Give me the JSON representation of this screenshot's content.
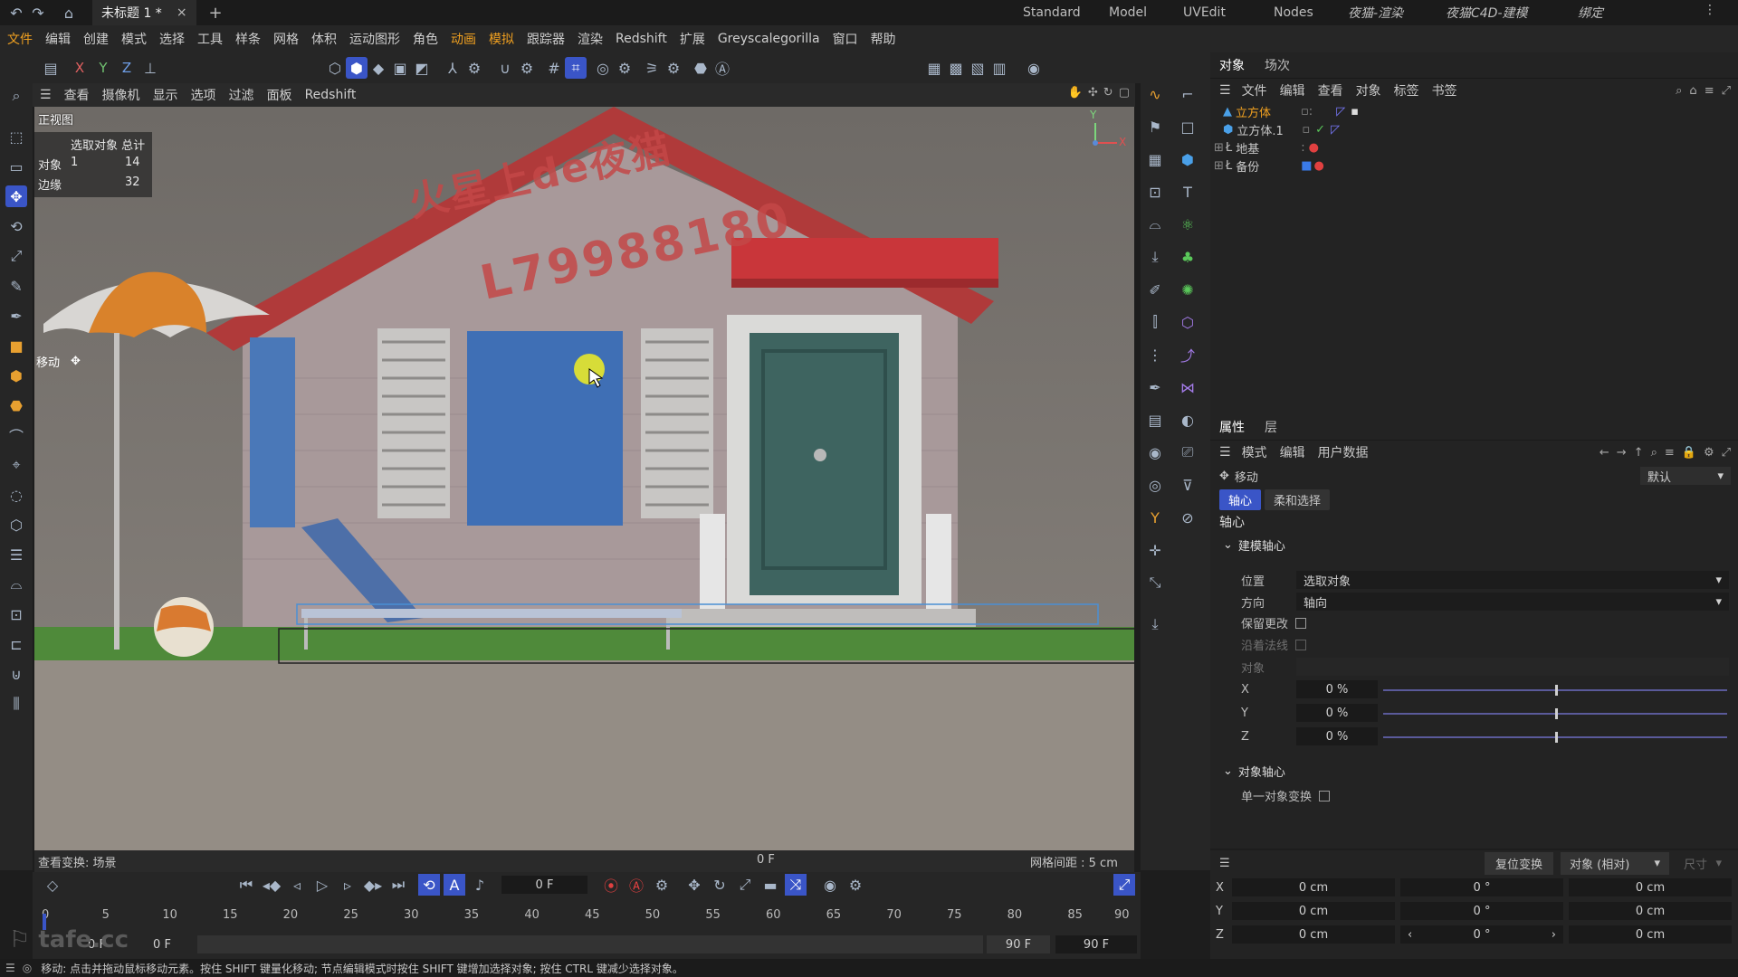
{
  "window": {
    "doc_tab": "未标题 1 *",
    "layouts": [
      "Standard",
      "Model",
      "UVEdit",
      "Nodes",
      "夜猫-渲染",
      "夜猫C4D-建模",
      "绑定"
    ]
  },
  "menu": [
    "文件",
    "编辑",
    "创建",
    "模式",
    "选择",
    "工具",
    "样条",
    "网格",
    "体积",
    "运动图形",
    "角色",
    "动画",
    "模拟",
    "跟踪器",
    "渲染",
    "Redshift",
    "扩展",
    "Greyscalegorilla",
    "窗口",
    "帮助"
  ],
  "axes": {
    "x": "X",
    "y": "Y",
    "z": "Z"
  },
  "viewport_menu": [
    "查看",
    "摄像机",
    "显示",
    "选项",
    "过滤",
    "面板",
    "Redshift"
  ],
  "viewport": {
    "name": "正视图",
    "stats": {
      "header": "选取对象 总计",
      "rows": [
        {
          "label": "对象",
          "selected": "1",
          "total": "14"
        },
        {
          "label": "边缘",
          "selected": "",
          "total": "32"
        }
      ]
    },
    "tool_label": "移动",
    "watermark_line1": "火星上de夜猫",
    "watermark_line2": "L79988180",
    "footer_left": "查看变换: 场景",
    "footer_center": "0 F",
    "footer_right": "网格间距 : 5 cm",
    "axis_y": "Y",
    "axis_x": "X"
  },
  "object_panel": {
    "tabs": [
      "对象",
      "场次"
    ],
    "menu": [
      "文件",
      "编辑",
      "查看",
      "对象",
      "标签",
      "书签"
    ],
    "items": [
      "立方体",
      "立方体.1",
      "地基",
      "备份"
    ]
  },
  "attr_panel": {
    "tabs": [
      "属性",
      "层"
    ],
    "menu": [
      "模式",
      "编辑",
      "用户数据"
    ],
    "tool": "移动",
    "preset": "默认",
    "subtabs": [
      "轴心",
      "柔和选择"
    ],
    "section": "轴心",
    "group1": "建模轴心",
    "position_label": "位置",
    "position_value": "选取对象",
    "direction_label": "方向",
    "direction_value": "轴向",
    "keep_changes": "保留更改",
    "along_normal": "沿着法线",
    "object_label": "对象",
    "x_label": "X",
    "y_label": "Y",
    "z_label": "Z",
    "x_value": "0 %",
    "y_value": "0 %",
    "z_value": "0 %",
    "slider_fraction": 0.5,
    "group2": "对象轴心",
    "single_object": "单一对象变换"
  },
  "coords": {
    "reset": "复位变换",
    "mode": "对象 (相对)",
    "size_label": "尺寸",
    "rows": [
      {
        "axis": "X",
        "pos": "0 cm",
        "rot": "0 °",
        "size": "0 cm"
      },
      {
        "axis": "Y",
        "pos": "0 cm",
        "rot": "0 °",
        "size": "0 cm"
      },
      {
        "axis": "Z",
        "pos": "0 cm",
        "rot": "0 °",
        "size": "0 cm"
      }
    ]
  },
  "timeline": {
    "current_frame": "0 F",
    "ruler": [
      "0",
      "5",
      "10",
      "15",
      "20",
      "25",
      "30",
      "35",
      "40",
      "45",
      "50",
      "55",
      "60",
      "65",
      "70",
      "75",
      "80",
      "85",
      "90"
    ],
    "start": "0 F",
    "start2": "0 F",
    "end": "90 F",
    "end2": "90 F"
  },
  "logo_text": "tafe.cc",
  "status": "移动: 点击并拖动鼠标移动元素。按住 SHIFT 键量化移动; 节点编辑模式时按住 SHIFT 键增加选择对象; 按住 CTRL 键减少选择对象。",
  "colors": {
    "accent": "#3a55c7",
    "selected_orange": "#f0a020"
  }
}
